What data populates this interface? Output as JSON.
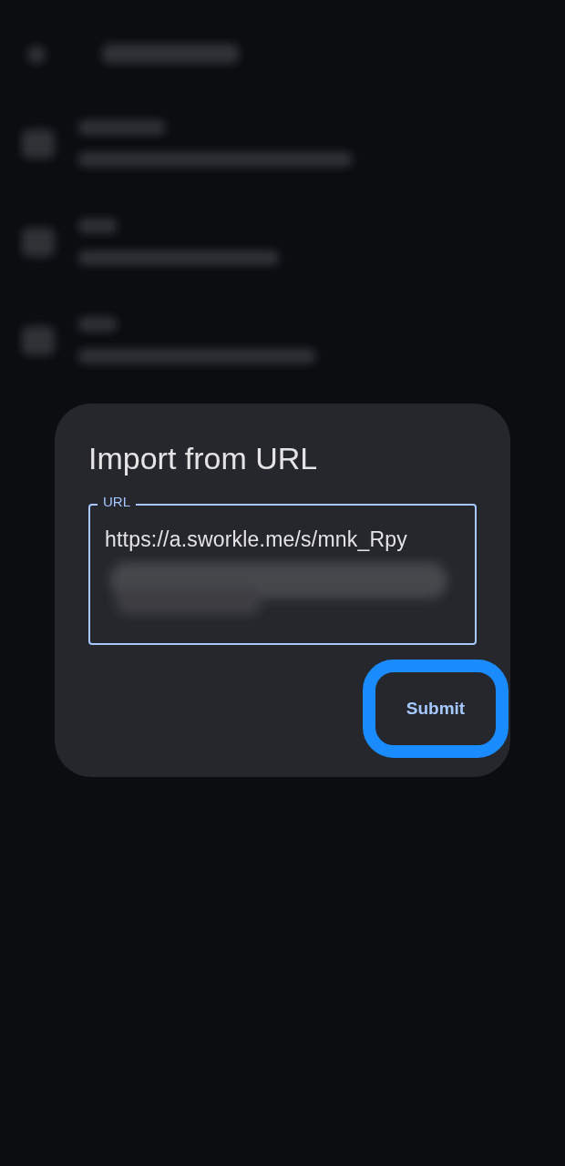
{
  "dialog": {
    "title": "Import from URL",
    "url_field": {
      "label": "URL",
      "value": "https://a.sworkle.me/s/mnk_Rpy",
      "redacted": true
    },
    "buttons": [
      {
        "label": "Submit",
        "highlighted": true
      }
    ]
  }
}
